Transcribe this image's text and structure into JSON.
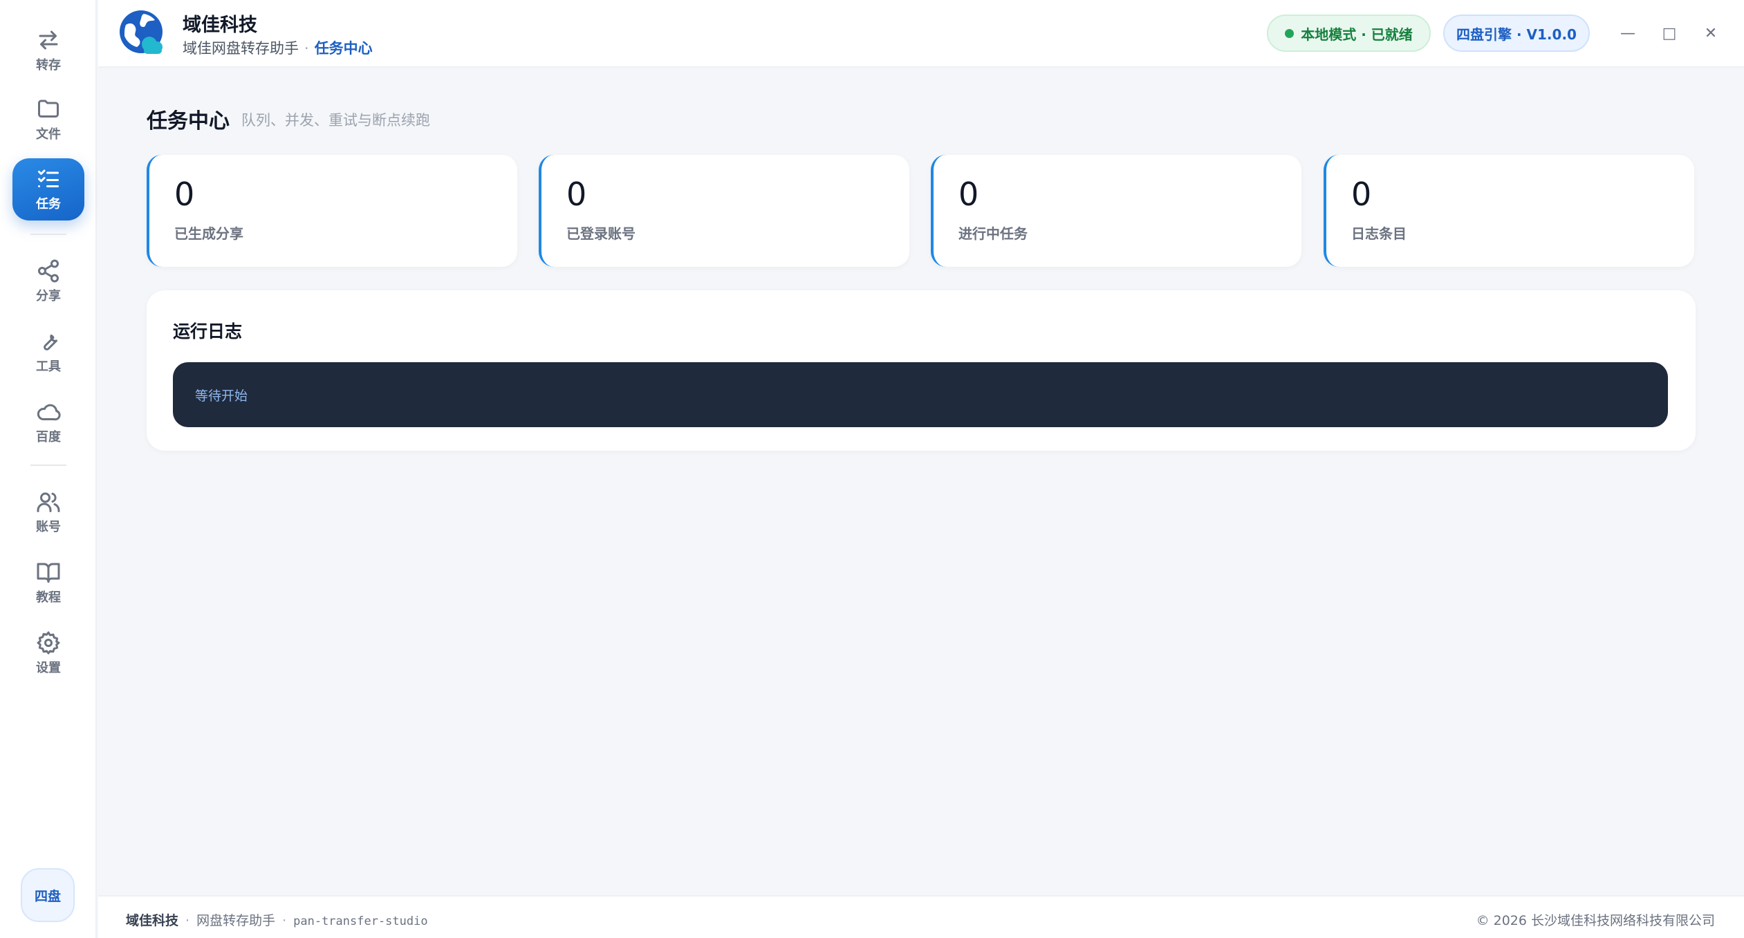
{
  "sidebar": {
    "items": [
      {
        "label": "转存",
        "icon": "transfer-arrows-icon"
      },
      {
        "label": "文件",
        "icon": "folder-icon"
      },
      {
        "label": "任务",
        "icon": "task-checklist-icon",
        "active": true
      },
      {
        "label": "分享",
        "icon": "share-icon"
      },
      {
        "label": "工具",
        "icon": "wrench-icon"
      },
      {
        "label": "百度",
        "icon": "cloud-icon"
      },
      {
        "label": "账号",
        "icon": "users-icon"
      },
      {
        "label": "教程",
        "icon": "book-icon"
      },
      {
        "label": "设置",
        "icon": "gear-icon"
      }
    ],
    "engine_chip": "四盘"
  },
  "header": {
    "brand_title": "域佳科技",
    "app_name": "域佳网盘转存助手",
    "separator": "·",
    "current_page": "任务中心",
    "status_text": "本地模式 · 已就绪",
    "version_text": "四盘引擎 · V1.0.0",
    "window_controls": {
      "minimize": "—",
      "maximize": "□",
      "close": "✕"
    }
  },
  "main": {
    "title": "任务中心",
    "subtitle": "队列、并发、重试与断点续跑",
    "stats": [
      {
        "value": "0",
        "label": "已生成分享"
      },
      {
        "value": "0",
        "label": "已登录账号"
      },
      {
        "value": "0",
        "label": "进行中任务"
      },
      {
        "value": "0",
        "label": "日志条目"
      }
    ],
    "log": {
      "title": "运行日志",
      "lines": [
        "等待开始"
      ]
    }
  },
  "footer": {
    "brand": "域佳科技",
    "separator": "·",
    "product": "网盘转存助手",
    "code_name": "pan-transfer-studio",
    "copyright": "© 2026 长沙域佳科技网络科技有限公司"
  },
  "colors": {
    "accent": "#1565c8",
    "accent_light": "#2b8ae6",
    "status_green": "#15803d",
    "console_bg": "#1f2a3c",
    "page_bg": "#f4f6f9"
  }
}
